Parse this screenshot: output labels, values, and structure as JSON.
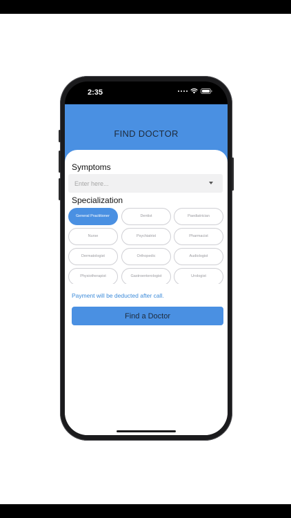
{
  "status_bar": {
    "time": "2:35"
  },
  "header": {
    "title": "FIND DOCTOR"
  },
  "symptoms": {
    "title": "Symptoms",
    "placeholder": "Enter here..."
  },
  "specialization": {
    "title": "Specialization",
    "chips": [
      {
        "label": "General Practitioner",
        "selected": true
      },
      {
        "label": "Dentist",
        "selected": false
      },
      {
        "label": "Paediatrician",
        "selected": false
      },
      {
        "label": "Nurse",
        "selected": false
      },
      {
        "label": "Psychiatrist",
        "selected": false
      },
      {
        "label": "Pharmacist",
        "selected": false
      },
      {
        "label": "Dermatologist",
        "selected": false
      },
      {
        "label": "Orthopedic",
        "selected": false
      },
      {
        "label": "Audiologist",
        "selected": false
      },
      {
        "label": "Physiotherapist",
        "selected": false
      },
      {
        "label": "Gastroenterologist",
        "selected": false
      },
      {
        "label": "Urologist",
        "selected": false
      }
    ]
  },
  "payment_note": "Payment will be deducted after call.",
  "find_button": {
    "label": "Find a Doctor"
  },
  "colors": {
    "primary": "#4a90e2",
    "note_text": "#3b8ad9",
    "chip_border": "#cfcfd4"
  }
}
